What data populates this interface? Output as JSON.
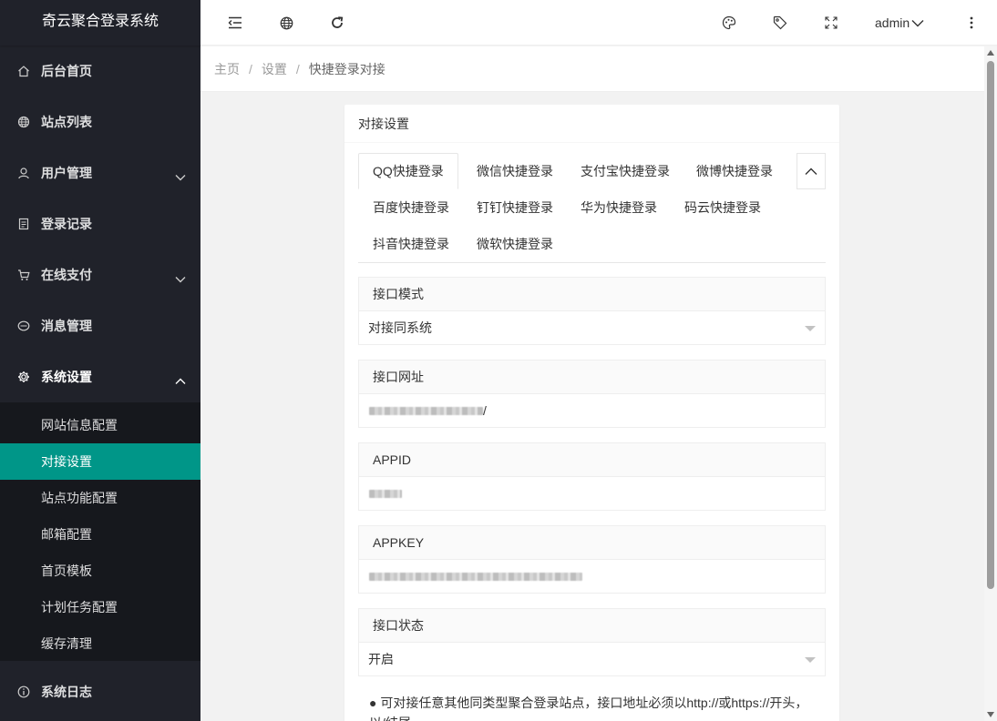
{
  "app": {
    "title": "奇云聚合登录系统"
  },
  "sidebar": {
    "items": [
      {
        "label": "后台首页",
        "icon": "home-icon"
      },
      {
        "label": "站点列表",
        "icon": "globe-icon"
      },
      {
        "label": "用户管理",
        "icon": "user-icon"
      },
      {
        "label": "登录记录",
        "icon": "document-icon"
      },
      {
        "label": "在线支付",
        "icon": "cart-icon"
      },
      {
        "label": "消息管理",
        "icon": "message-icon"
      },
      {
        "label": "系统设置",
        "icon": "gear-icon"
      },
      {
        "label": "系统日志",
        "icon": "info-icon"
      }
    ],
    "sub_items": [
      {
        "label": "网站信息配置"
      },
      {
        "label": "对接设置"
      },
      {
        "label": "站点功能配置"
      },
      {
        "label": "邮箱配置"
      },
      {
        "label": "首页模板"
      },
      {
        "label": "计划任务配置"
      },
      {
        "label": "缓存清理"
      }
    ]
  },
  "header": {
    "user": "admin",
    "icons": [
      "menu-fold-icon",
      "globe-icon",
      "refresh-icon",
      "palette-icon",
      "tag-icon",
      "fullscreen-icon",
      "more-icon"
    ]
  },
  "breadcrumb": [
    "主页",
    "设置",
    "快捷登录对接"
  ],
  "card": {
    "title": "对接设置",
    "tabs": [
      "QQ快捷登录",
      "微信快捷登录",
      "支付宝快捷登录",
      "微博快捷登录",
      "百度快捷登录",
      "钉钉快捷登录",
      "华为快捷登录",
      "码云快捷登录",
      "抖音快捷登录",
      "微软快捷登录"
    ],
    "active_tab": "QQ快捷登录",
    "fields": {
      "mode": {
        "label": "接口模式",
        "value": "对接同系统"
      },
      "url": {
        "label": "接口网址",
        "value_suffix": "/"
      },
      "appid": {
        "label": "APPID"
      },
      "appkey": {
        "label": "APPKEY"
      },
      "status": {
        "label": "接口状态",
        "value": "开启"
      }
    },
    "note": "● 可对接任意其他同类型聚合登录站点，接口地址必须以http://或https://开头，以/结尾"
  },
  "colors": {
    "sidebar_bg": "#20222a",
    "submenu_bg": "#16181d",
    "accent": "#009688"
  }
}
